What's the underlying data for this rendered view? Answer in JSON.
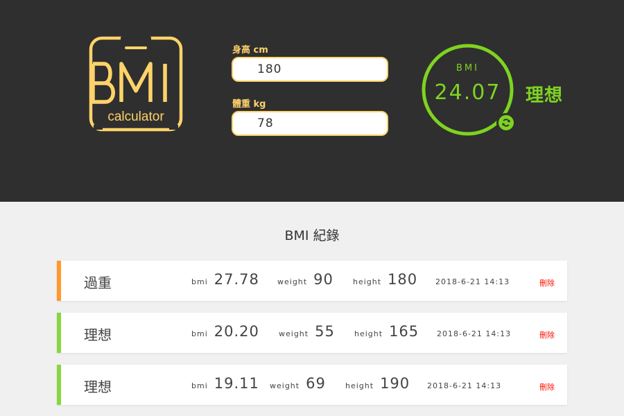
{
  "logo": {
    "title": "BMI",
    "subtitle": "calculator",
    "color": "#ffd36a"
  },
  "form": {
    "height_label": "身高 cm",
    "height_value": "180",
    "weight_label": "體重 kg",
    "weight_value": "78"
  },
  "result": {
    "label": "BMI",
    "value": "24.07",
    "status": "理想",
    "color": "#7ed321",
    "reset_icon": "refresh-icon"
  },
  "records": {
    "title": "BMI 紀錄",
    "bmi_key": "bmi",
    "weight_key": "weight",
    "height_key": "height",
    "delete_label": "刪除",
    "items": [
      {
        "status": "過重",
        "bmi": "27.78",
        "weight": "90",
        "height": "180",
        "date": "2018-6-21 14:13",
        "color": "#ff982d"
      },
      {
        "status": "理想",
        "bmi": "20.20",
        "weight": "55",
        "height": "165",
        "date": "2018-6-21 14:13",
        "color": "#86d73f"
      },
      {
        "status": "理想",
        "bmi": "19.11",
        "weight": "69",
        "height": "190",
        "date": "2018-6-21 14:13",
        "color": "#86d73f"
      }
    ]
  },
  "colors": {
    "header_bg": "#2f2f2f",
    "page_bg": "#f0f0f0",
    "accent": "#ffd36a",
    "ideal": "#7ed321",
    "overweight": "#ff982d",
    "delete": "#ff1200"
  }
}
